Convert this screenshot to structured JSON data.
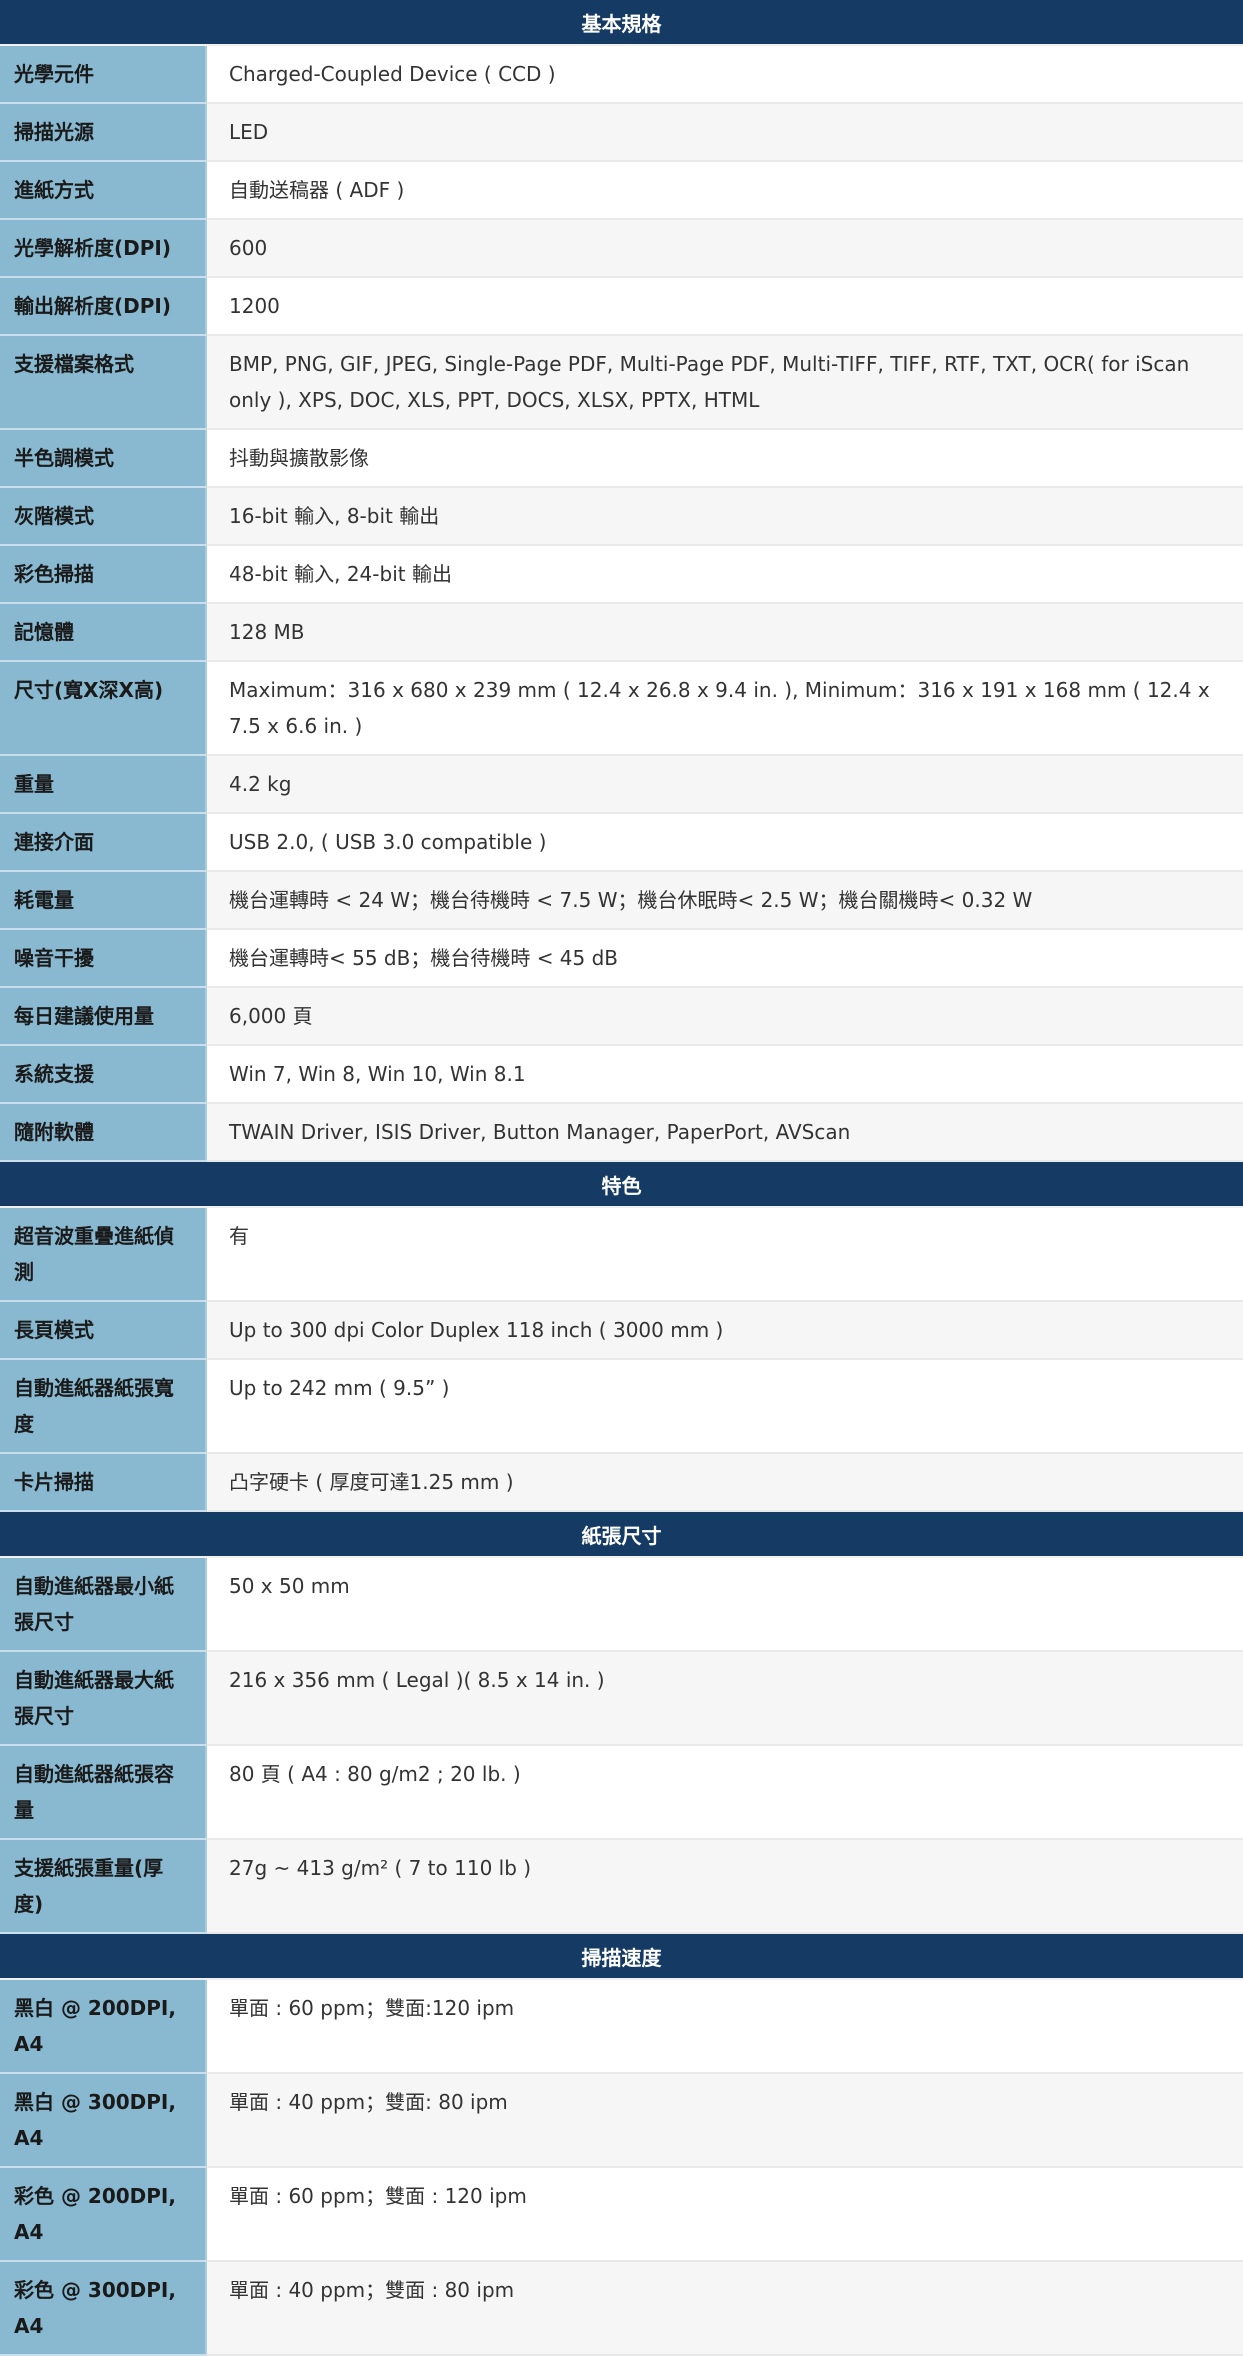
{
  "sections": [
    {
      "title": "基本規格",
      "rows": [
        {
          "label": "光學元件",
          "value": "Charged-Coupled Device ( CCD )"
        },
        {
          "label": "掃描光源",
          "value": "LED"
        },
        {
          "label": "進紙方式",
          "value": "自動送稿器 ( ADF )"
        },
        {
          "label": "光學解析度(DPI)",
          "value": "600"
        },
        {
          "label": "輸出解析度(DPI)",
          "value": "1200"
        },
        {
          "label": "支援檔案格式",
          "value": "BMP, PNG, GIF, JPEG, Single-Page PDF, Multi-Page PDF, Multi-TIFF, TIFF, RTF, TXT, OCR( for iScan only ), XPS, DOC, XLS, PPT, DOCS, XLSX, PPTX, HTML"
        },
        {
          "label": "半色調模式",
          "value": "抖動與擴散影像"
        },
        {
          "label": "灰階模式",
          "value": "16-bit 輸入, 8-bit 輸出"
        },
        {
          "label": "彩色掃描",
          "value": "48-bit 輸入, 24-bit 輸出"
        },
        {
          "label": "記憶體",
          "value": "128 MB"
        },
        {
          "label": "尺寸(寬X深X高)",
          "value": "Maximum：316 x 680 x 239 mm ( 12.4 x 26.8 x 9.4 in. ), Minimum：316 x 191 x 168 mm ( 12.4 x 7.5 x 6.6 in. )"
        },
        {
          "label": "重量",
          "value": "4.2 kg"
        },
        {
          "label": "連接介面",
          "value": "USB 2.0, ( USB 3.0 compatible )"
        },
        {
          "label": "耗電量",
          "value": "機台運轉時 < 24 W；機台待機時 < 7.5 W；機台休眠時< 2.5 W；機台關機時< 0.32 W"
        },
        {
          "label": "噪音干擾",
          "value": "機台運轉時< 55 dB；機台待機時 < 45 dB"
        },
        {
          "label": "每日建議使用量",
          "value": "6,000 頁"
        },
        {
          "label": "系統支援",
          "value": "Win 7, Win 8, Win 10, Win 8.1"
        },
        {
          "label": "隨附軟體",
          "value": "TWAIN Driver, ISIS Driver, Button Manager, PaperPort, AVScan"
        }
      ]
    },
    {
      "title": "特色",
      "rows": [
        {
          "label": "超音波重疊進紙偵測",
          "value": "有"
        },
        {
          "label": "長頁模式",
          "value": "Up to 300 dpi Color Duplex 118 inch ( 3000 mm )"
        },
        {
          "label": "自動進紙器紙張寬度",
          "value": "Up to 242 mm ( 9.5” )"
        },
        {
          "label": "卡片掃描",
          "value": "凸字硬卡 ( 厚度可達1.25 mm )"
        }
      ]
    },
    {
      "title": "紙張尺寸",
      "rows": [
        {
          "label": "自動進紙器最小紙張尺寸",
          "value": "50 x 50 mm"
        },
        {
          "label": "自動進紙器最大紙張尺寸",
          "value": "216 x 356 mm ( Legal )( 8.5 x 14 in. )"
        },
        {
          "label": "自動進紙器紙張容量",
          "value": "80 頁 ( A4 : 80 g/m2 ; 20 lb. )"
        },
        {
          "label": "支援紙張重量(厚度)",
          "value": "27g ~ 413 g/m² ( 7 to 110 lb )"
        }
      ]
    },
    {
      "title": "掃描速度",
      "rows": [
        {
          "label": "黑白 @ 200DPI, A4",
          "value": "單面 : 60 ppm；雙面:120 ipm"
        },
        {
          "label": "黑白 @ 300DPI, A4",
          "value": "單面 : 40 ppm；雙面: 80 ipm"
        },
        {
          "label": "彩色 @ 200DPI, A4",
          "value": "單面 : 60 ppm；雙面 : 120 ipm"
        },
        {
          "label": "彩色 @ 300DPI, A4",
          "value": "單面 : 40 ppm；雙面 : 80 ipm"
        }
      ]
    }
  ]
}
